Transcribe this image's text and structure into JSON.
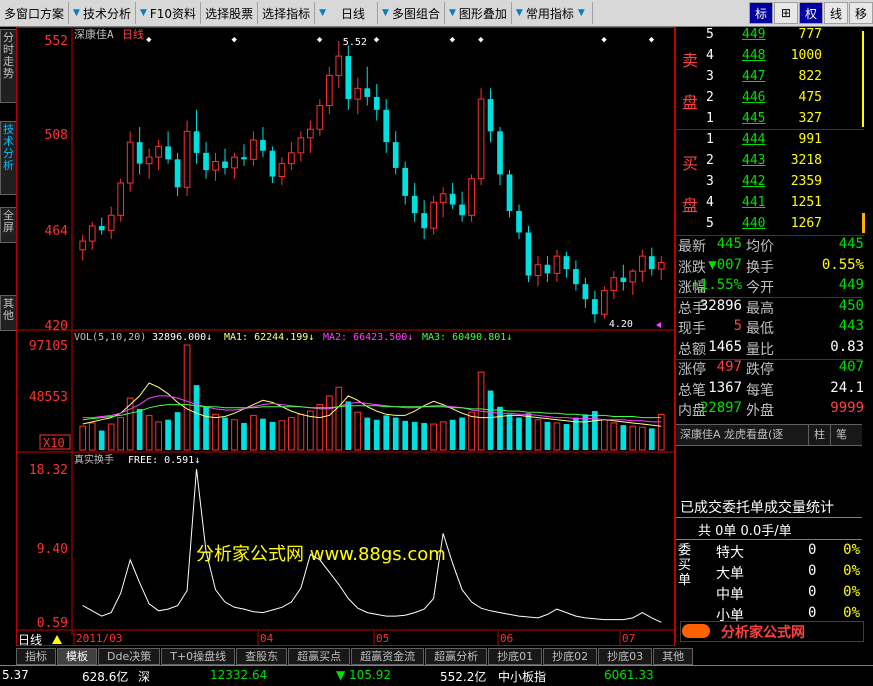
{
  "toolbar": {
    "items": [
      "多窗口方案",
      "技术分析",
      "F10资料",
      "选择股票",
      "选择指标",
      "日线",
      "多图组合",
      "图形叠加",
      "常用指标"
    ],
    "right_buttons": [
      "标",
      "⊞",
      "权",
      "线",
      "移"
    ]
  },
  "sidetabs": [
    "分时走势",
    "技术分析",
    "全屏",
    "其他"
  ],
  "chart": {
    "title": "深康佳A",
    "period": "日线",
    "price_axis": [
      "552",
      "508",
      "464",
      "420"
    ],
    "high_label": "5.52",
    "low_label": "4.20",
    "vol_header": {
      "vol": "VOL(5,10,20)",
      "vol_val": "32896.000↓",
      "ma1": "MA1: 62244.199↓",
      "ma2": "MA2: 66423.500↓",
      "ma3": "MA3: 60490.801↓"
    },
    "vol_axis": [
      "97105",
      "48553",
      "X10"
    ],
    "turn_header": {
      "label": "真实换手",
      "free": "FREE: 0.591↓"
    },
    "turn_axis": [
      "18.32",
      "9.40",
      "0.59"
    ],
    "watermark": "分析家公式网 www.88gs.com",
    "date_axis": {
      "period": "日线",
      "labels": [
        "2011/03",
        "04",
        "05",
        "06",
        "07"
      ]
    },
    "colors": {
      "up": "#ff3030",
      "down": "#00e0e0",
      "ma1": "#ffff80",
      "ma2": "#ff40ff",
      "ma3": "#40ff40"
    }
  },
  "chart_data": [
    {
      "type": "candlestick",
      "title": "深康佳A 日线",
      "ylim": [
        420,
        560
      ],
      "yticks": [
        "552",
        "508",
        "464",
        "420"
      ],
      "candles": [
        [
          455,
          462,
          450,
          459
        ],
        [
          459,
          468,
          455,
          466
        ],
        [
          466,
          470,
          462,
          464
        ],
        [
          464,
          475,
          460,
          471
        ],
        [
          471,
          488,
          468,
          486
        ],
        [
          486,
          510,
          482,
          505
        ],
        [
          505,
          512,
          490,
          495
        ],
        [
          495,
          502,
          488,
          498
        ],
        [
          498,
          506,
          492,
          503
        ],
        [
          503,
          510,
          495,
          497
        ],
        [
          497,
          500,
          480,
          484
        ],
        [
          484,
          515,
          480,
          510
        ],
        [
          510,
          520,
          495,
          500
        ],
        [
          500,
          505,
          488,
          492
        ],
        [
          492,
          500,
          487,
          496
        ],
        [
          496,
          502,
          490,
          493
        ],
        [
          493,
          500,
          488,
          498
        ],
        [
          498,
          504,
          494,
          497
        ],
        [
          497,
          510,
          494,
          506
        ],
        [
          506,
          512,
          498,
          501
        ],
        [
          501,
          503,
          486,
          489
        ],
        [
          489,
          498,
          485,
          495
        ],
        [
          495,
          505,
          492,
          500
        ],
        [
          500,
          510,
          496,
          507
        ],
        [
          507,
          515,
          500,
          511
        ],
        [
          511,
          525,
          508,
          522
        ],
        [
          522,
          540,
          518,
          536
        ],
        [
          536,
          552,
          530,
          545
        ],
        [
          545,
          550,
          520,
          525
        ],
        [
          525,
          535,
          518,
          530
        ],
        [
          530,
          540,
          522,
          526
        ],
        [
          526,
          532,
          515,
          520
        ],
        [
          520,
          525,
          500,
          505
        ],
        [
          505,
          510,
          490,
          493
        ],
        [
          493,
          496,
          476,
          480
        ],
        [
          480,
          486,
          468,
          472
        ],
        [
          472,
          478,
          460,
          465
        ],
        [
          465,
          480,
          462,
          477
        ],
        [
          477,
          484,
          470,
          481
        ],
        [
          481,
          486,
          474,
          476
        ],
        [
          476,
          482,
          468,
          471
        ],
        [
          471,
          490,
          468,
          488
        ],
        [
          488,
          530,
          485,
          525
        ],
        [
          525,
          530,
          505,
          510
        ],
        [
          510,
          512,
          485,
          490
        ],
        [
          490,
          492,
          470,
          473
        ],
        [
          473,
          476,
          460,
          463
        ],
        [
          463,
          466,
          440,
          443
        ],
        [
          443,
          452,
          438,
          448
        ],
        [
          448,
          452,
          440,
          444
        ],
        [
          444,
          455,
          440,
          452
        ],
        [
          452,
          454,
          442,
          446
        ],
        [
          446,
          450,
          436,
          439
        ],
        [
          439,
          442,
          428,
          432
        ],
        [
          432,
          436,
          421,
          425
        ],
        [
          425,
          438,
          423,
          436
        ],
        [
          436,
          445,
          432,
          442
        ],
        [
          442,
          448,
          436,
          440
        ],
        [
          440,
          446,
          434,
          445
        ],
        [
          445,
          455,
          440,
          452
        ],
        [
          452,
          456,
          443,
          446
        ],
        [
          446,
          452,
          441,
          449
        ]
      ]
    },
    {
      "type": "bar",
      "title": "VOL(5,10,20)",
      "ylim": [
        0,
        97105
      ],
      "yticks": [
        "97105",
        "48553"
      ],
      "values": [
        22000,
        25000,
        18000,
        24000,
        30000,
        48000,
        38000,
        32000,
        26000,
        28000,
        35000,
        97105,
        60000,
        40000,
        33000,
        30000,
        28000,
        25000,
        32000,
        29000,
        26000,
        27000,
        30000,
        33000,
        36000,
        42000,
        50000,
        58000,
        45000,
        35000,
        30000,
        28000,
        32000,
        30000,
        27000,
        26000,
        25000,
        24000,
        26000,
        28000,
        30000,
        35000,
        72000,
        55000,
        40000,
        33000,
        30000,
        34000,
        28000,
        26000,
        25000,
        24000,
        30000,
        33000,
        36000,
        28000,
        25000,
        23000,
        22000,
        21000,
        20000,
        32896
      ],
      "series": [
        {
          "name": "MA1",
          "values": [
            24000,
            26000,
            28000,
            30000,
            34000,
            42000,
            50000,
            62000,
            58000,
            52000,
            44000,
            38000,
            34000,
            31000,
            30000,
            31000,
            34000,
            38000,
            42000,
            46000,
            44000,
            40000,
            36000,
            33000,
            31000,
            30000,
            32000,
            40000,
            50000,
            46000,
            40000,
            36000,
            33000,
            32000,
            32000,
            36000,
            41000,
            45000,
            42000,
            38000,
            34000,
            31000,
            30000,
            30000,
            31000,
            32000,
            32000,
            31000,
            30000,
            29000,
            28000,
            27000,
            26000,
            26000,
            27000,
            28000,
            27000,
            26000,
            25000,
            24000,
            23000,
            22000
          ]
        },
        {
          "name": "MA2",
          "values": [
            30000,
            30000,
            31000,
            32000,
            34000,
            38000,
            42000,
            48000,
            50000,
            50000,
            48000,
            45000,
            42000,
            40000,
            38000,
            37000,
            37000,
            38000,
            40000,
            42000,
            43000,
            42000,
            41000,
            40000,
            39000,
            38000,
            38000,
            40000,
            43000,
            44000,
            43000,
            42000,
            41000,
            40000,
            39000,
            39000,
            40000,
            41000,
            41000,
            40000,
            39000,
            37000,
            36000,
            35000,
            34000,
            34000,
            33000,
            33000,
            32000,
            31000,
            30000,
            30000,
            29000,
            29000,
            29000,
            28000,
            28000,
            28000,
            27000,
            27000,
            26000,
            26000
          ]
        },
        {
          "name": "MA3",
          "values": [
            28000,
            29000,
            30000,
            31000,
            32000,
            34000,
            36000,
            39000,
            41000,
            42000,
            42000,
            42000,
            41000,
            40000,
            40000,
            39000,
            39000,
            39000,
            39000,
            40000,
            40000,
            40000,
            40000,
            40000,
            39000,
            39000,
            39000,
            40000,
            41000,
            41000,
            41000,
            41000,
            40000,
            40000,
            40000,
            40000,
            40000,
            40000,
            40000,
            39000,
            39000,
            38000,
            38000,
            37000,
            37000,
            36000,
            36000,
            35000,
            35000,
            34000,
            34000,
            33000,
            33000,
            32000,
            32000,
            32000,
            31000,
            31000,
            31000,
            30000,
            30000,
            30000
          ]
        }
      ]
    },
    {
      "type": "line",
      "title": "真实换手",
      "ylim": [
        0.59,
        18.32
      ],
      "yticks": [
        "18.32",
        "9.40",
        "0.59"
      ],
      "series": [
        {
          "name": "FREE",
          "values": [
            2.8,
            2.2,
            1.6,
            2.0,
            4.2,
            8.0,
            5.4,
            3.0,
            2.2,
            2.4,
            2.8,
            4.5,
            18.32,
            9.0,
            4.6,
            3.2,
            2.6,
            2.4,
            2.1,
            2.0,
            2.3,
            2.6,
            3.2,
            4.8,
            8.6,
            8.0,
            6.6,
            5.2,
            3.6,
            2.5,
            2.0,
            1.8,
            1.6,
            1.6,
            1.7,
            2.0,
            2.4,
            3.6,
            11.0,
            7.6,
            4.6,
            3.2,
            2.5,
            2.2,
            2.0,
            1.8,
            1.6,
            1.5,
            1.4,
            1.8,
            2.4,
            2.0,
            1.6,
            1.4,
            1.3,
            1.2,
            1.2,
            1.2,
            1.4,
            2.0,
            1.4,
            0.9
          ]
        }
      ]
    }
  ],
  "panel": {
    "sell_label": [
      "卖",
      "盘"
    ],
    "buy_label": [
      "买",
      "盘"
    ],
    "sell": [
      {
        "lvl": "5",
        "price": "449",
        "vol": "777"
      },
      {
        "lvl": "4",
        "price": "448",
        "vol": "1000"
      },
      {
        "lvl": "3",
        "price": "447",
        "vol": "822"
      },
      {
        "lvl": "2",
        "price": "446",
        "vol": "475"
      },
      {
        "lvl": "1",
        "price": "445",
        "vol": "327"
      }
    ],
    "buy": [
      {
        "lvl": "1",
        "price": "444",
        "vol": "991"
      },
      {
        "lvl": "2",
        "price": "443",
        "vol": "3218"
      },
      {
        "lvl": "3",
        "price": "442",
        "vol": "2359"
      },
      {
        "lvl": "4",
        "price": "441",
        "vol": "1251"
      },
      {
        "lvl": "5",
        "price": "440",
        "vol": "1267"
      }
    ],
    "quote": [
      {
        "k1": "最新",
        "v1": "445",
        "k2": "均价",
        "v2": "445"
      },
      {
        "k1": "涨跌",
        "v1": "▼007",
        "k2": "换手",
        "v2": "0.55%"
      },
      {
        "k1": "涨幅",
        "v1": "-1.55%",
        "k2": "今开",
        "v2": "449"
      },
      {
        "k1": "总手",
        "v1": "32896",
        "k2": "最高",
        "v2": "450"
      },
      {
        "k1": "现手",
        "v1": "5",
        "k2": "最低",
        "v2": "443"
      },
      {
        "k1": "总额",
        "v1": "1465",
        "k2": "量比",
        "v2": "0.83"
      },
      {
        "k1": "涨停",
        "v1": "497",
        "k2": "跌停",
        "v2": "407"
      },
      {
        "k1": "总笔",
        "v1": "1367",
        "k2": "每笔",
        "v2": "24.1"
      },
      {
        "k1": "内盘",
        "v1": "22897",
        "k2": "外盘",
        "v2": "9999"
      }
    ],
    "subtabs": [
      "深康佳A 龙虎看盘(逐",
      "柱",
      "笔"
    ],
    "stats_title": "已成交委托单成交量统计",
    "stats_header": "共 0单 0.0手/单",
    "stats_side": "委买单",
    "stats_rows": [
      {
        "name": "特大",
        "v": "0",
        "p": "0%"
      },
      {
        "name": "大单",
        "v": "0",
        "p": "0%"
      },
      {
        "name": "中单",
        "v": "0",
        "p": "0%"
      },
      {
        "name": "小单",
        "v": "0",
        "p": "0%"
      }
    ],
    "logo_text": "分析家公式网",
    "logo_url": "www.88gs.com"
  },
  "bottom_tabs": [
    "指标",
    "模板",
    "Dde决策",
    "T+0操盘线",
    "查股东",
    "超赢买点",
    "超赢资金流",
    "超赢分析",
    "抄底01",
    "抄底02",
    "抄底03",
    "其他"
  ],
  "status": {
    "v1": "5.37",
    "v2": "628.6亿",
    "v3": "深",
    "v4": "12332.64",
    "v5": "▼ 105.92",
    "v6": "552.2亿",
    "v7": "中小板指",
    "v8": "6061.33"
  }
}
